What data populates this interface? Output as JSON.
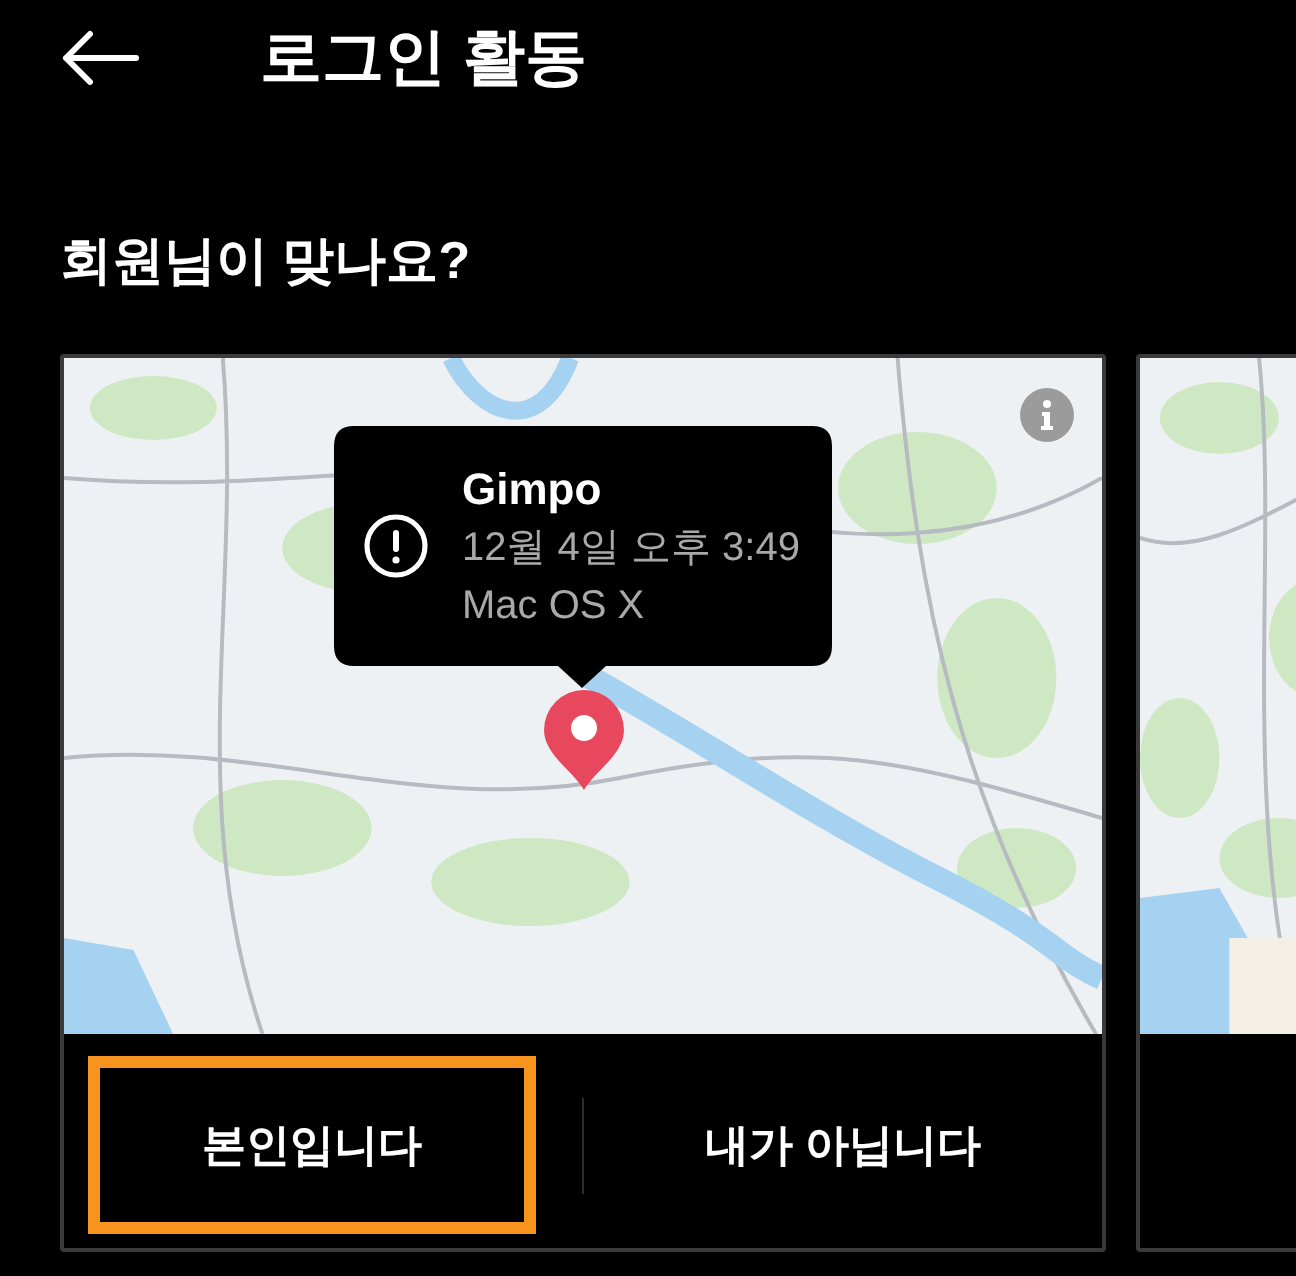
{
  "header": {
    "title": "로그인 활동"
  },
  "section": {
    "title": "회원님이 맞나요?"
  },
  "cards": [
    {
      "kind": "full",
      "popup": {
        "location": "Gimpo",
        "time": "12월 4일 오후 3:49",
        "device": "Mac OS X"
      },
      "buttons": [
        {
          "label": "본인입니다",
          "highlighted": true
        },
        {
          "label": "내가 아닙니다",
          "highlighted": false
        }
      ]
    },
    {
      "kind": "peek"
    }
  ]
}
